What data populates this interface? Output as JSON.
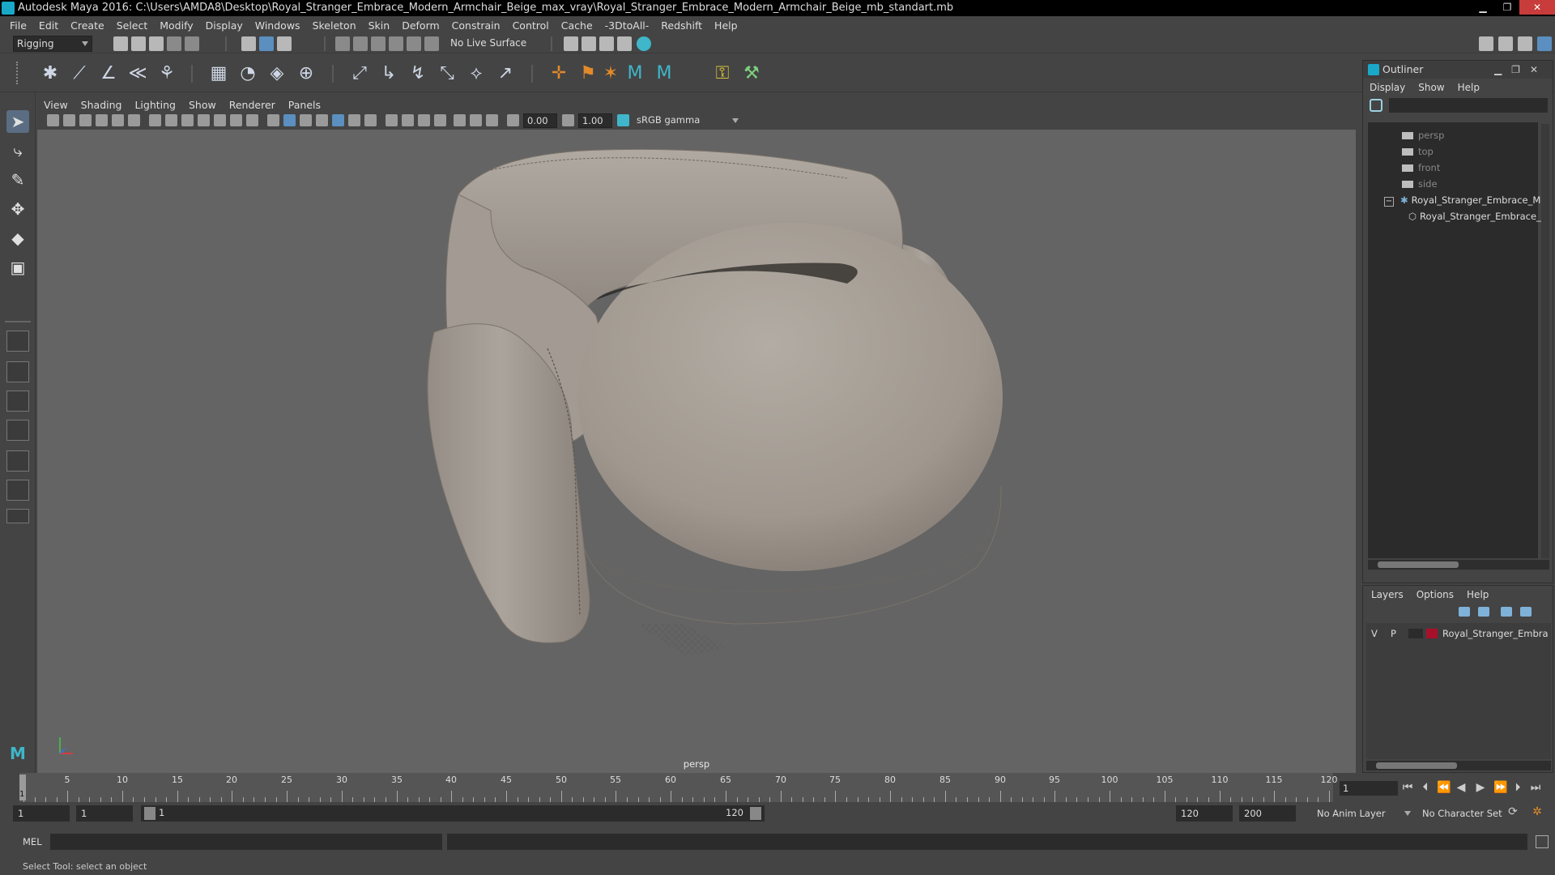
{
  "window": {
    "title": "Autodesk Maya 2016: C:\\Users\\AMDA8\\Desktop\\Royal_Stranger_Embrace_Modern_Armchair_Beige_max_vray\\Royal_Stranger_Embrace_Modern_Armchair_Beige_mb_standart.mb",
    "minimize": "▁",
    "restore": "❐",
    "close": "✕"
  },
  "menubar": [
    "File",
    "Edit",
    "Create",
    "Select",
    "Modify",
    "Display",
    "Windows",
    "Skeleton",
    "Skin",
    "Deform",
    "Constrain",
    "Control",
    "Cache",
    "-3DtoAll-",
    "Redshift",
    "Help"
  ],
  "statusline": {
    "menuset": "Rigging",
    "live_surface": "No Live Surface"
  },
  "viewport": {
    "menu": [
      "View",
      "Shading",
      "Lighting",
      "Show",
      "Renderer",
      "Panels"
    ],
    "exposure": "0.00",
    "gamma": "1.00",
    "colorspace": "sRGB gamma",
    "camera_label": "persp",
    "colors": {
      "background": "#646464",
      "fabric": "#a59d95"
    }
  },
  "outliner": {
    "title": "Outliner",
    "menu": [
      "Display",
      "Show",
      "Help"
    ],
    "items": [
      {
        "label": "persp"
      },
      {
        "label": "top"
      },
      {
        "label": "front"
      },
      {
        "label": "side"
      },
      {
        "label": "Royal_Stranger_Embrace_Mo",
        "expander": "−"
      },
      {
        "label": "Royal_Stranger_Embrace_"
      }
    ]
  },
  "layers": {
    "menu": [
      "Layers",
      "Options",
      "Help"
    ],
    "row": {
      "v": "V",
      "p": "P",
      "name": "Royal_Stranger_Embra",
      "color": "#a8102a"
    }
  },
  "timeslider": {
    "ticks": [
      "5",
      "10",
      "15",
      "20",
      "25",
      "30",
      "35",
      "40",
      "45",
      "50",
      "55",
      "60",
      "65",
      "70",
      "75",
      "80",
      "85",
      "90",
      "95",
      "100",
      "105",
      "110",
      "115",
      "120"
    ],
    "playhead_label": "1",
    "current_frame": "1"
  },
  "rangeslider": {
    "start": "1",
    "start_inner": "1",
    "bar_start": "1",
    "bar_end": "120",
    "end_inner": "120",
    "end": "200",
    "anim_layer": "No Anim Layer",
    "char_set": "No Character Set"
  },
  "cmdline": {
    "label": "MEL"
  },
  "helpline": {
    "text": "Select Tool: select an object"
  }
}
